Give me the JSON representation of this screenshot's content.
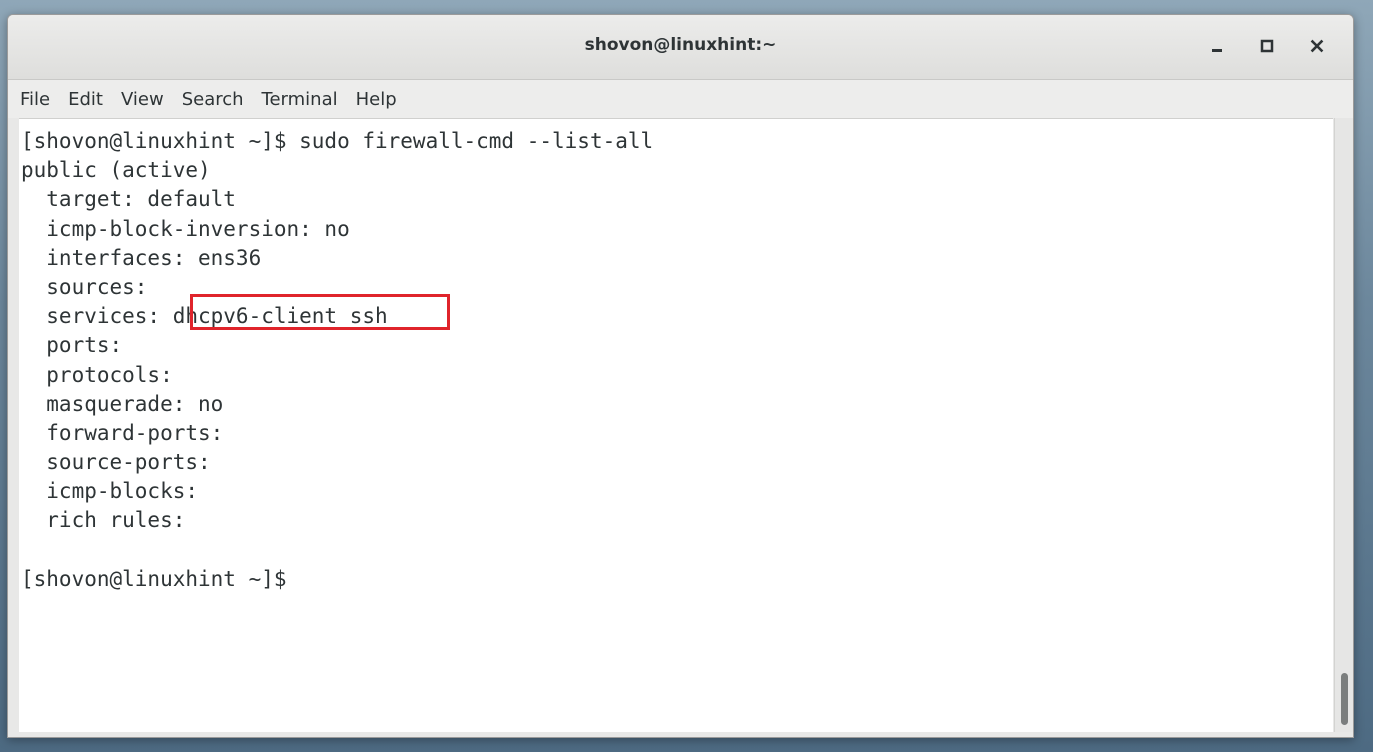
{
  "window": {
    "title": "shovon@linuxhint:~",
    "minimize_icon": "minimize-icon",
    "maximize_icon": "maximize-icon",
    "close_icon": "close-icon"
  },
  "menubar": {
    "items": [
      "File",
      "Edit",
      "View",
      "Search",
      "Terminal",
      "Help"
    ]
  },
  "terminal": {
    "lines": [
      "[shovon@linuxhint ~]$ sudo firewall-cmd --list-all",
      "public (active)",
      "  target: default",
      "  icmp-block-inversion: no",
      "  interfaces: ens36",
      "  sources: ",
      "  services: dhcpv6-client ssh",
      "  ports: ",
      "  protocols: ",
      "  masquerade: no",
      "  forward-ports: ",
      "  source-ports: ",
      "  icmp-blocks: ",
      "  rich rules: ",
      "",
      "[shovon@linuxhint ~]$ "
    ],
    "highlighted_text": "dhcpv6-client ssh",
    "highlight_color": "#e0242b",
    "text_color": "#2e3436",
    "background_color": "#ffffff"
  }
}
